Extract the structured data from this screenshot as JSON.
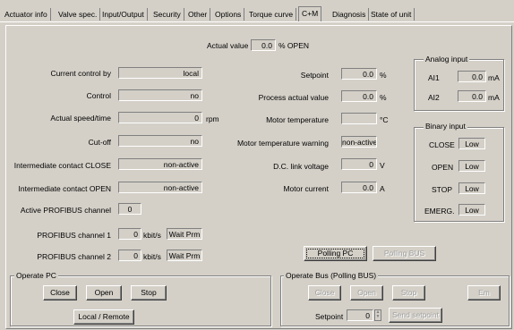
{
  "tabs": [
    "Actuator info",
    "Valve spec.",
    "Input/Output",
    "Security",
    "Other",
    "Options",
    "Torque curve",
    "C+M",
    "Diagnosis",
    "State of unit"
  ],
  "actual": {
    "label": "Actual value",
    "value": "0.0",
    "unit": "% OPEN"
  },
  "left": {
    "current_control_by": {
      "label": "Current control by",
      "value": "local"
    },
    "control": {
      "label": "Control",
      "value": "no"
    },
    "speed": {
      "label": "Actual speed/time",
      "value": "0",
      "unit": "rpm"
    },
    "cutoff": {
      "label": "Cut-off",
      "value": "no"
    },
    "ic_close": {
      "label": "Intermediate contact CLOSE",
      "value": "non-active"
    },
    "ic_open": {
      "label": "Intermediate contact OPEN",
      "value": "non-active"
    },
    "profibus_active": {
      "label": "Active PROFIBUS channel",
      "value": "0"
    },
    "pb1": {
      "label": "PROFIBUS channel 1",
      "value": "0",
      "unit": "kbit/s",
      "status": "Wait Prm"
    },
    "pb2": {
      "label": "PROFIBUS channel 2",
      "value": "0",
      "unit": "kbit/s",
      "status": "Wait Prm"
    }
  },
  "mid": {
    "setpoint": {
      "label": "Setpoint",
      "value": "0.0",
      "unit": "%"
    },
    "process": {
      "label": "Process actual value",
      "value": "0.0",
      "unit": "%"
    },
    "motor_temp": {
      "label": "Motor temperature",
      "value": "",
      "unit": "°C"
    },
    "motor_warn": {
      "label": "Motor temperature warning",
      "value": "non-active"
    },
    "dc_link": {
      "label": "D.C. link voltage",
      "value": "0",
      "unit": "V"
    },
    "motor_current": {
      "label": "Motor current",
      "value": "0.0",
      "unit": "A"
    }
  },
  "analog": {
    "title": "Analog input",
    "ai1": {
      "label": "AI1",
      "value": "0.0",
      "unit": "mA"
    },
    "ai2": {
      "label": "AI2",
      "value": "0.0",
      "unit": "mA"
    }
  },
  "binary": {
    "title": "Binary input",
    "close": {
      "label": "CLOSE",
      "value": "Low"
    },
    "open": {
      "label": "OPEN",
      "value": "Low"
    },
    "stop": {
      "label": "STOP",
      "value": "Low"
    },
    "emerg": {
      "label": "EMERG.",
      "value": "Low"
    }
  },
  "polling": {
    "pc": "Polling PC",
    "bus": "Polling BUS"
  },
  "operate_pc": {
    "title": "Operate PC",
    "close": "Close",
    "open": "Open",
    "stop": "Stop",
    "local_remote": "Local / Remote"
  },
  "operate_bus": {
    "title": "Operate Bus (Polling BUS)",
    "close": "Close",
    "open": "Open",
    "stop": "Stop",
    "em": "Em",
    "setpoint_label": "Setpoint",
    "setpoint_value": "0",
    "send": "Send setpoint"
  }
}
